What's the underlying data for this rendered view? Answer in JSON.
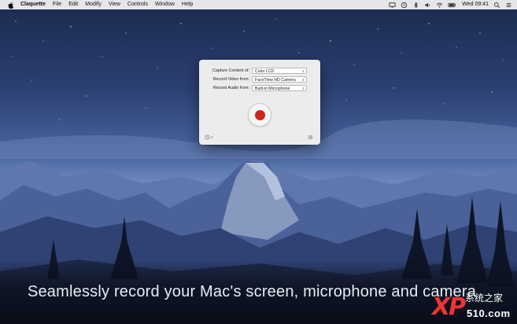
{
  "menubar": {
    "app_name": "Claquette",
    "menus": [
      "File",
      "Edit",
      "Modify",
      "View",
      "Controls",
      "Window",
      "Help"
    ],
    "clock": "Wed 09:41",
    "status_icons": [
      "display-icon",
      "time-machine-icon",
      "bluetooth-icon",
      "volume-icon",
      "wifi-icon",
      "battery-icon",
      "spotlight-icon",
      "notification-center-icon"
    ]
  },
  "window": {
    "rows": [
      {
        "label": "Capture Content of:",
        "value": "Color LCD"
      },
      {
        "label": "Record Video from:",
        "value": "FaceTime HD Camera"
      },
      {
        "label": "Record Audio from:",
        "value": "Built-in Microphone"
      }
    ],
    "record_icon": "record-icon",
    "history_icon": "history-clock-icon",
    "settings_icon": "gear-icon"
  },
  "caption": "Seamlessly record your Mac's screen, microphone and camera",
  "watermark": {
    "large": "XP",
    "small": "系统之家",
    "number": "510.com"
  },
  "colors": {
    "record": "#c9271e",
    "menubar": "#eeeef0",
    "window": "#ececec"
  }
}
